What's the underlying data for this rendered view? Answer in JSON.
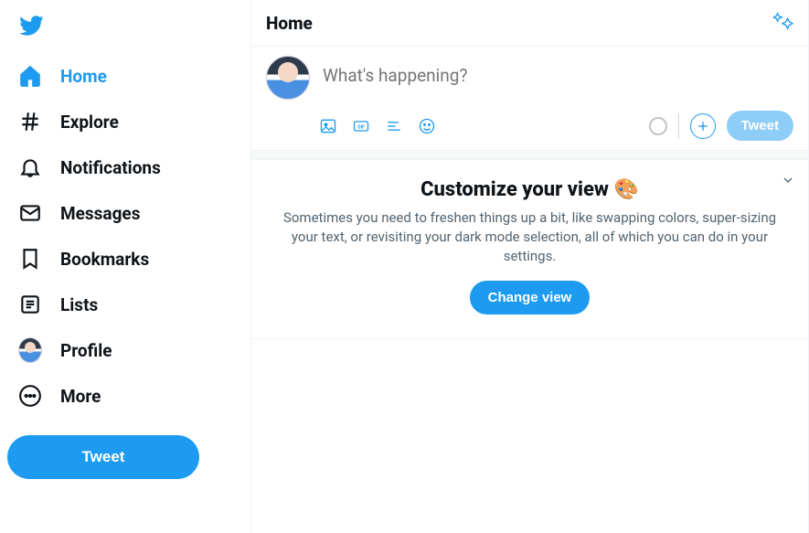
{
  "header": {
    "title": "Home"
  },
  "sidebar": {
    "items": [
      {
        "label": "Home"
      },
      {
        "label": "Explore"
      },
      {
        "label": "Notifications"
      },
      {
        "label": "Messages"
      },
      {
        "label": "Bookmarks"
      },
      {
        "label": "Lists"
      },
      {
        "label": "Profile"
      },
      {
        "label": "More"
      }
    ],
    "tweet_button": "Tweet"
  },
  "compose": {
    "placeholder": "What's happening?",
    "tweet_button": "Tweet"
  },
  "card": {
    "title": "Customize your view",
    "emoji": "🎨",
    "description": "Sometimes you need to freshen things up a bit, like swapping colors, super-sizing your text, or revisiting your dark mode selection, all of which you can do in your settings.",
    "button": "Change view"
  }
}
